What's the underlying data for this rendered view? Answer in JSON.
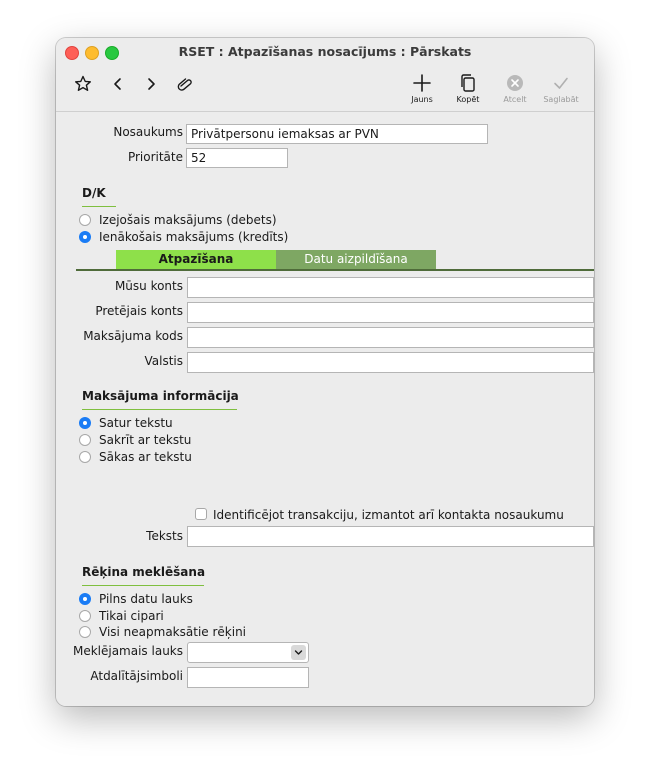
{
  "window": {
    "title": "RSET : Atpazīšanas nosacījums : Pārskats"
  },
  "toolbar": {
    "new_label": "Jauns",
    "copy_label": "Kopēt",
    "cancel_label": "Atcelt",
    "save_label": "Saglabāt"
  },
  "form": {
    "name_label": "Nosaukums",
    "name_value": "Privātpersonu iemaksas ar PVN",
    "priority_label": "Prioritāte",
    "priority_value": "52"
  },
  "dk": {
    "title": "D/K",
    "options": [
      {
        "label": "Izejošais maksājums (debets)",
        "selected": false
      },
      {
        "label": "Ienākošais maksājums (kredīts)",
        "selected": true
      }
    ]
  },
  "tabs": [
    {
      "label": "Atpazīšana",
      "active": true
    },
    {
      "label": "Datu aizpildīšana",
      "active": false
    }
  ],
  "fields": {
    "our_account_label": "Mūsu konts",
    "counter_account_label": "Pretējais konts",
    "payment_code_label": "Maksājuma kods",
    "countries_label": "Valstis",
    "text_label": "Teksts",
    "search_field_label": "Meklējamais lauks",
    "separators_label": "Atdalītājsimboli"
  },
  "payment_info": {
    "title": "Maksājuma informācija",
    "options": [
      {
        "label": "Satur tekstu",
        "selected": true
      },
      {
        "label": "Sakrīt ar tekstu",
        "selected": false
      },
      {
        "label": "Sākas ar tekstu",
        "selected": false
      }
    ],
    "checkbox_label": "Identificējot transakciju, izmantot arī kontakta nosaukumu",
    "checkbox_checked": false
  },
  "invoice_search": {
    "title": "Rēķina meklēšana",
    "options": [
      {
        "label": "Pilns datu lauks",
        "selected": true
      },
      {
        "label": "Tikai cipari",
        "selected": false
      },
      {
        "label": "Visi neapmaksātie rēķini",
        "selected": false
      }
    ]
  },
  "colors": {
    "tab_active": "#8ee04a",
    "tab_inactive": "#7ea763",
    "radio_selected": "#1a7cf5",
    "section_underline": "#7fbf3f"
  }
}
